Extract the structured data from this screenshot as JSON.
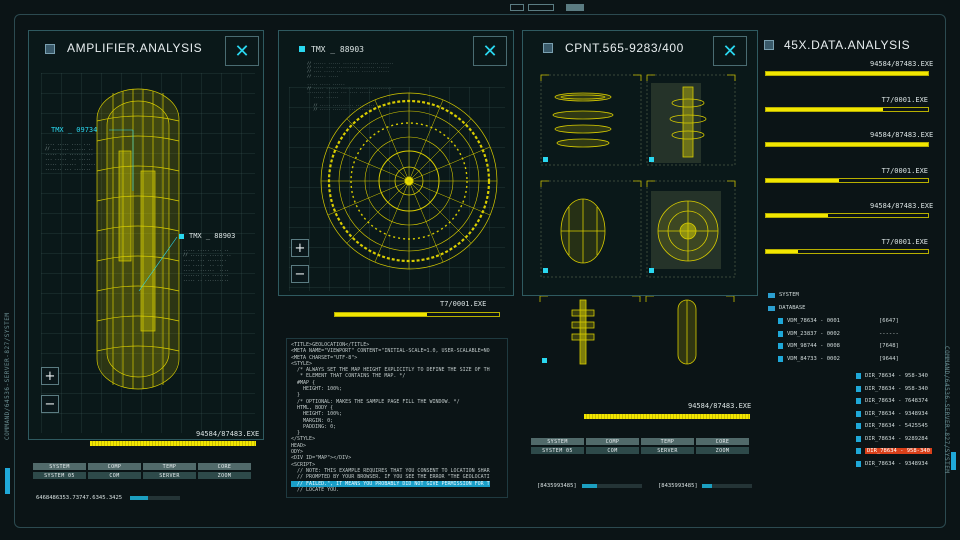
{
  "side_labels": {
    "left": "COMMAND/64536-SERVER-827/SYSTEM",
    "right": "COMMAND/64536-SERVER-827/SYSTEM"
  },
  "panels": {
    "amplifier": {
      "title": "AMPLIFIER.ANALYSIS",
      "close_icon": "✕",
      "labels": {
        "tmx_top": "TMX _ 09734",
        "tmx_mid": "TMX _ 88903"
      },
      "zoom_in": "+",
      "zoom_out": "−",
      "exe_label": "94584/87483.EXE",
      "buttons": [
        {
          "label": "SYSTEM",
          "dark": false
        },
        {
          "label": "COMP",
          "dark": false
        },
        {
          "label": "TEMP",
          "dark": false
        },
        {
          "label": "CORE",
          "dark": false
        },
        {
          "label": "SYSTEM 05",
          "dark": true
        },
        {
          "label": "COM",
          "dark": true
        },
        {
          "label": "SERVER",
          "dark": true
        },
        {
          "label": "ZOOM",
          "dark": true
        }
      ],
      "status": "6468486353.73747.6345.3425",
      "status_progress": 0.35
    },
    "tmx": {
      "title": "TMX _ 88903",
      "close_icon": "✕",
      "zoom_in": "+",
      "zoom_out": "−",
      "exe_label": "T7/0001.EXE",
      "code": [
        "<TITLE>GEOLOCATION</TITLE>",
        "<META NAME=\"VIEWPORT\" CONTENT=\"INITIAL-SCALE=1.0, USER-SCALABLE=NO",
        "<META CHARSET=\"UTF-8\">",
        "<STYLE>",
        "  /* ALWAYS SET THE MAP HEIGHT EXPLICITLY TO DEFINE THE SIZE OF TH",
        "   * ELEMENT THAT CONTAINS THE MAP. */",
        "  #MAP {",
        "    HEIGHT: 100%;",
        "  }",
        "  /* OPTIONAL: MAKES THE SAMPLE PAGE FILL THE WINDOW. */",
        "  HTML, BODY {",
        "    HEIGHT: 100%;",
        "    MARGIN: 0;",
        "    PADDING: 0;",
        "  }",
        "</STYLE>",
        "HEAD>",
        "ODY>",
        "<DIV ID=\"MAP\"></DIV>",
        "<SCRIPT>",
        "  // NOTE: THIS EXAMPLE REQUIRES THAT YOU CONSENT TO LOCATION SHAR",
        "  // PROMPTED BY YOUR BROWSER. IF YOU SEE THE ERROR \"THE GEOLOCATI"
      ],
      "code_highlight": "  // FAILED.\", IT MEANS YOU PROBABLY DID NOT GIVE PERMISSION FOR T",
      "code_last": "  // LOCATE YOU."
    },
    "cpnt": {
      "title": "CPNT.565-9283/400",
      "close_icon": "✕",
      "exe_label": "94584/87483.EXE",
      "buttons": [
        {
          "label": "SYSTEM",
          "dark": false
        },
        {
          "label": "COMP",
          "dark": false
        },
        {
          "label": "TEMP",
          "dark": false
        },
        {
          "label": "CORE",
          "dark": false
        },
        {
          "label": "SYSTEM 05",
          "dark": true
        },
        {
          "label": "COM",
          "dark": true
        },
        {
          "label": "SERVER",
          "dark": true
        },
        {
          "label": "ZOOM",
          "dark": true
        }
      ],
      "status_left": "[8435993485]",
      "status_left_progress": 0.25,
      "status_right": "[8435993485]",
      "status_right_progress": 0.2
    },
    "data": {
      "title": "45X.DATA.ANALYSIS",
      "rows": [
        {
          "label": "94584/87483.EXE",
          "progress": 1.0
        },
        {
          "label": "T7/0001.EXE",
          "progress": 0.72
        },
        {
          "label": "94584/87483.EXE",
          "progress": 1.0
        },
        {
          "label": "T7/0001.EXE",
          "progress": 0.45
        },
        {
          "label": "94584/87483.EXE",
          "progress": 0.38
        },
        {
          "label": "T7/0001.EXE",
          "progress": 0.2
        }
      ],
      "tree": {
        "system": "SYSTEM",
        "database": "DATABASE",
        "vdm": [
          {
            "name": "VDM_78634 - 0001",
            "value": "[6647]"
          },
          {
            "name": "VDM_23837 - 0002",
            "value": "------"
          },
          {
            "name": "VDM_98744 - 0008",
            "value": "[7648]"
          },
          {
            "name": "VDM_84733 - 0002",
            "value": "[9644]"
          }
        ],
        "dirs": [
          {
            "name": "DIR_78634 - 958-340",
            "selected": false
          },
          {
            "name": "DIR_78634 - 958-340",
            "selected": false
          },
          {
            "name": "DIR_78634 - 7648374",
            "selected": false
          },
          {
            "name": "DIR_78634 - 9348934",
            "selected": false
          },
          {
            "name": "DIR_78634 - 5425545",
            "selected": false
          },
          {
            "name": "DIR_78634 - 9289284",
            "selected": false
          },
          {
            "name": "DIR_78634 - 958-340",
            "selected": true
          },
          {
            "name": "DIR_78634 - 9348934",
            "selected": false
          }
        ]
      }
    }
  },
  "colors": {
    "accent": "#2ad8f0",
    "yellow": "#f2e600",
    "selection": "#d9401a"
  }
}
